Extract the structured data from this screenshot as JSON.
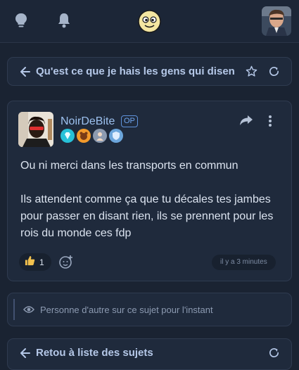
{
  "header": {
    "icons": [
      "lightbulb-icon",
      "bell-icon",
      "site-logo",
      "user-avatar"
    ]
  },
  "topic": {
    "title": "Qu'est ce que je hais les gens qui disen",
    "icons": [
      "back-arrow-icon",
      "star-icon",
      "refresh-icon"
    ]
  },
  "post": {
    "author": "NoirDeBite",
    "op_badge": "OP",
    "badges": [
      "diamond-badge",
      "bear-badge",
      "avatar-badge",
      "shield-badge"
    ],
    "text_1": "Ou ni merci dans les transports en commun",
    "text_2": "Ils attendent comme ça que tu décales tes jambes pour passer en disant rien, ils se prennent pour les rois du monde ces fdp",
    "like_count": "1",
    "timestamp": "il y a 3 minutes"
  },
  "presence": {
    "message": "Personne d'autre sur ce sujet pour l'instant"
  },
  "footer": {
    "back_label": "Retou à liste des sujets"
  },
  "colors": {
    "background": "#1a2332",
    "card": "#1f2a3c",
    "accent": "#9dc1ef",
    "text": "#dbe3ef"
  }
}
